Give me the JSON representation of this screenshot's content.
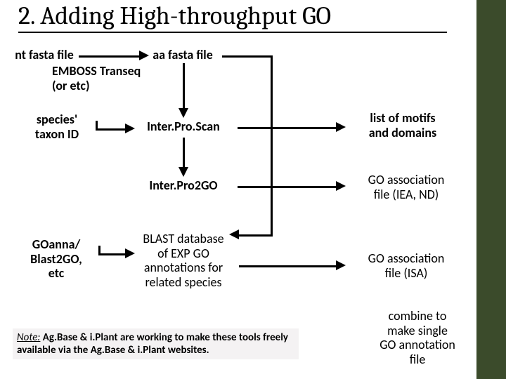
{
  "title": "2. Adding High-throughput GO",
  "nodes": {
    "nt_fasta": "nt fasta file",
    "aa_fasta": "aa fasta file",
    "emboss": "EMBOSS Transeq\n(or etc)",
    "taxon": "species'\ntaxon ID",
    "interproscan": "Inter.Pro.Scan",
    "interpro2go": "Inter.Pro2GO",
    "goanna": "GOanna/\nBlast2GO,\netc",
    "blast_db": "BLAST database\nof EXP GO\nannotations for\nrelated species",
    "motifs": "list of motifs\nand domains",
    "ga_iea": "GO association\nfile (IEA, ND)",
    "ga_isa": "GO association\nfile (ISA)",
    "combine": "combine to\nmake single\nGO annotation\nfile"
  },
  "note": {
    "lead": "Note:",
    "body": " Ag.Base & i.Plant are working to make these tools freely available via the Ag.Base & i.Plant websites."
  }
}
